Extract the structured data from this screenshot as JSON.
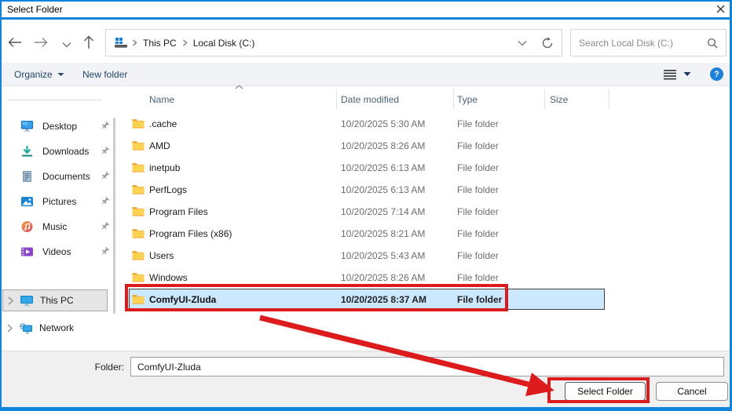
{
  "window": {
    "title": "Select Folder"
  },
  "nav": {
    "crumbs": {
      "root": "This PC",
      "current": "Local Disk (C:)"
    },
    "search_placeholder": "Search Local Disk (C:)"
  },
  "toolbar": {
    "organize": "Organize",
    "new_folder": "New folder",
    "help_label": "?"
  },
  "sidebar": {
    "items": [
      {
        "label": "Desktop"
      },
      {
        "label": "Downloads"
      },
      {
        "label": "Documents"
      },
      {
        "label": "Pictures"
      },
      {
        "label": "Music"
      },
      {
        "label": "Videos"
      }
    ],
    "tree": [
      {
        "label": "This PC",
        "selected": true
      },
      {
        "label": "Network",
        "selected": false
      }
    ]
  },
  "files": {
    "columns": {
      "name": "Name",
      "date": "Date modified",
      "type": "Type",
      "size": "Size"
    },
    "rows": [
      {
        "name": ".cache",
        "date": "10/20/2025 5:30 AM",
        "type": "File folder"
      },
      {
        "name": "AMD",
        "date": "10/20/2025 8:26 AM",
        "type": "File folder"
      },
      {
        "name": "inetpub",
        "date": "10/20/2025 6:13 AM",
        "type": "File folder"
      },
      {
        "name": "PerfLogs",
        "date": "10/20/2025 6:13 AM",
        "type": "File folder"
      },
      {
        "name": "Program Files",
        "date": "10/20/2025 7:14 AM",
        "type": "File folder"
      },
      {
        "name": "Program Files (x86)",
        "date": "10/20/2025 8:21 AM",
        "type": "File folder"
      },
      {
        "name": "Users",
        "date": "10/20/2025 5:43 AM",
        "type": "File folder"
      },
      {
        "name": "Windows",
        "date": "10/20/2025 8:26 AM",
        "type": "File folder"
      },
      {
        "name": "ComfyUI-Zluda",
        "date": "10/20/2025 8:37 AM",
        "type": "File folder",
        "selected": true
      }
    ]
  },
  "footer": {
    "folder_label": "Folder:",
    "folder_value": "ComfyUI-Zluda",
    "select_button": "Select Folder",
    "cancel_button": "Cancel"
  },
  "colors": {
    "accent": "#1283da",
    "annotation_red": "#dc1c1c",
    "selection_fill": "#cce8ff",
    "toolbar_text": "#25476a",
    "folder_yellow": "#ffd152"
  }
}
